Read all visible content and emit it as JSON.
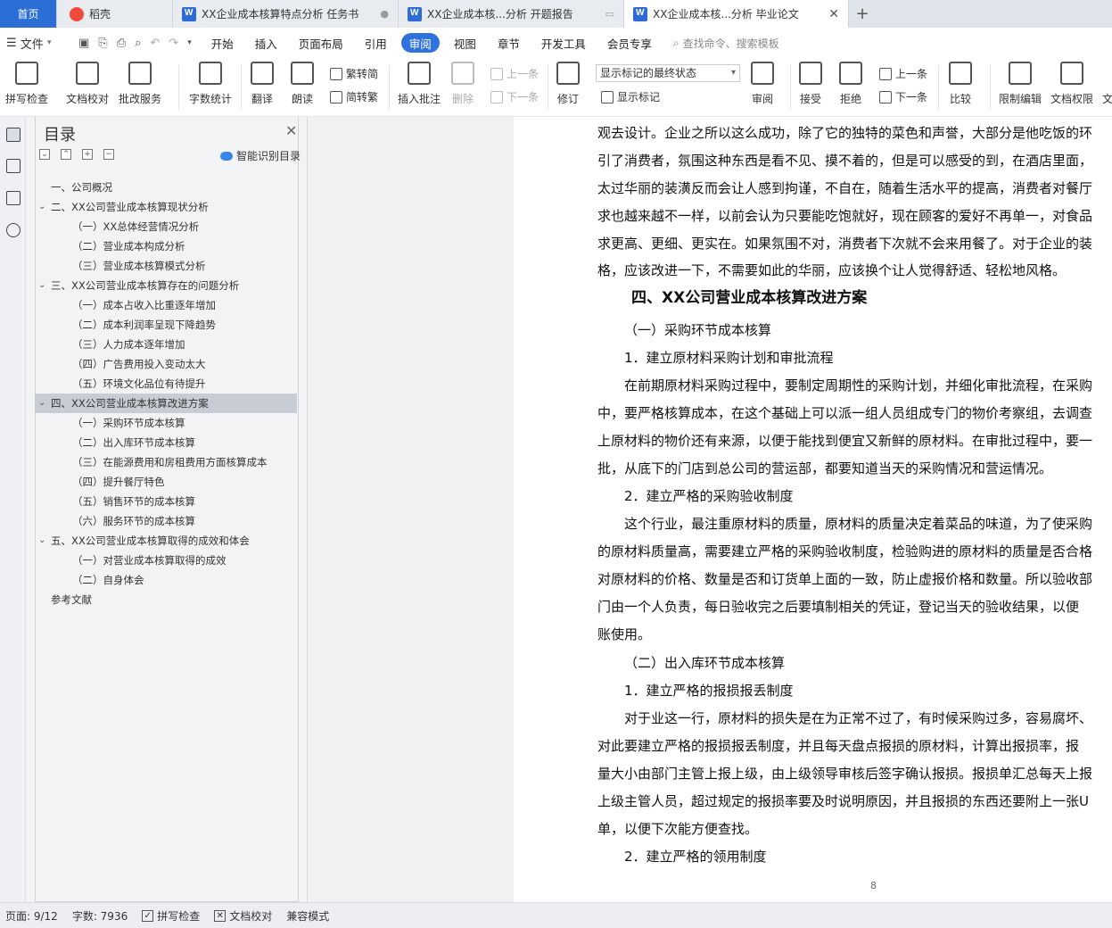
{
  "tabs": [
    {
      "label": "首页"
    },
    {
      "label": "稻壳"
    },
    {
      "label": "XX企业成本核算特点分析 任务书"
    },
    {
      "label": "XX企业成本核...分析 开题报告"
    },
    {
      "label": "XX企业成本核...分析 毕业论文"
    }
  ],
  "menu": {
    "file": "文件",
    "items": [
      "开始",
      "插入",
      "页面布局",
      "引用",
      "审阅",
      "视图",
      "章节",
      "开发工具",
      "会员专享"
    ],
    "search_placeholder": "查找命令、搜索模板"
  },
  "ribbon": {
    "spell": "拼写检查",
    "proof": "文档校对",
    "service": "批改服务",
    "wordcount": "字数统计",
    "translate": "翻译",
    "read": "朗读",
    "trad": "繁转简",
    "simp": "简转繁",
    "insert_comment": "插入批注",
    "delete": "删除",
    "prev": "上一条",
    "next": "下一条",
    "revise": "修订",
    "markup_select": "显示标记的最终状态",
    "show_markup": "显示标记",
    "review": "审阅",
    "accept": "接受",
    "reject": "拒绝",
    "prev2": "上一条",
    "next2": "下一条",
    "compare": "比较",
    "restrict": "限制编辑",
    "permission": "文档权限",
    "partial": "文"
  },
  "nav": {
    "title": "目录",
    "smart": "智能识别目录",
    "items": [
      {
        "text": "一、公司概况",
        "level": 1,
        "arrow": false
      },
      {
        "text": "二、XX公司营业成本核算现状分析",
        "level": 1,
        "arrow": true
      },
      {
        "text": "（一）XX总体经营情况分析",
        "level": 2
      },
      {
        "text": "（二）营业成本构成分析",
        "level": 2
      },
      {
        "text": "（三）营业成本核算模式分析",
        "level": 2
      },
      {
        "text": "三、XX公司营业成本核算存在的问题分析",
        "level": 1,
        "arrow": true
      },
      {
        "text": "（一）成本占收入比重逐年增加",
        "level": 2
      },
      {
        "text": "（二）成本利润率呈现下降趋势",
        "level": 2
      },
      {
        "text": "（三）人力成本逐年增加",
        "level": 2
      },
      {
        "text": "（四）广告费用投入变动太大",
        "level": 2
      },
      {
        "text": "（五）环境文化品位有待提升",
        "level": 2
      },
      {
        "text": "四、XX公司营业成本核算改进方案",
        "level": 1,
        "arrow": true,
        "selected": true
      },
      {
        "text": "（一）采购环节成本核算",
        "level": 2
      },
      {
        "text": "（二）出入库环节成本核算",
        "level": 2
      },
      {
        "text": "（三）在能源费用和房租费用方面核算成本",
        "level": 2
      },
      {
        "text": "（四）提升餐厅特色",
        "level": 2
      },
      {
        "text": "（五）销售环节的成本核算",
        "level": 2
      },
      {
        "text": "（六）服务环节的成本核算",
        "level": 2
      },
      {
        "text": "五、XX公司营业成本核算取得的成效和体会",
        "level": 1,
        "arrow": true
      },
      {
        "text": "（一）对营业成本核算取得的成效",
        "level": 2
      },
      {
        "text": "（二）自身体会",
        "level": 2
      },
      {
        "text": "参考文献",
        "level": 1,
        "arrow": false
      }
    ]
  },
  "doc": {
    "lines": [
      {
        "text": "观去设计。企业之所以这么成功，除了它的独特的菜色和声誉，大部分是他吃饭的环",
        "indent": 0
      },
      {
        "text": "引了消费者，氛围这种东西是看不见、摸不着的，但是可以感受的到，在酒店里面，",
        "indent": 0
      },
      {
        "text": "太过华丽的装潢反而会让人感到拘谨，不自在，随着生活水平的提高，消费者对餐厅",
        "indent": 0
      },
      {
        "text": "求也越来越不一样，以前会认为只要能吃饱就好，现在顾客的爱好不再单一，对食品",
        "indent": 0
      },
      {
        "text": "求更高、更细、更实在。如果氛围不对，消费者下次就不会来用餐了。对于企业的装",
        "indent": 0
      },
      {
        "text": "格，应该改进一下，不需要如此的华丽，应该换个让人觉得舒适、轻松地风格。",
        "indent": 0
      },
      {
        "text": "四、XX公司营业成本核算改进方案",
        "indent": 38,
        "heading": true
      },
      {
        "text": "（一）采购环节成本核算",
        "indent": 30
      },
      {
        "text": "1．建立原材料采购计划和审批流程",
        "indent": 30
      },
      {
        "text": "在前期原材料采购过程中，要制定周期性的采购计划，并细化审批流程，在采购",
        "indent": 30
      },
      {
        "text": "中，要严格核算成本，在这个基础上可以派一组人员组成专门的物价考察组，去调查",
        "indent": 0
      },
      {
        "text": "上原材料的物价还有来源，以便于能找到便宜又新鲜的原材料。在审批过程中，要一",
        "indent": 0
      },
      {
        "text": "批，从底下的门店到总公司的营运部，都要知道当天的采购情况和营运情况。",
        "indent": 0
      },
      {
        "text": "2．建立严格的采购验收制度",
        "indent": 30
      },
      {
        "text": "这个行业，最注重原材料的质量，原材料的质量决定着菜品的味道，为了使采购",
        "indent": 30
      },
      {
        "text": "的原材料质量高，需要建立严格的采购验收制度，检验购进的原材料的质量是否合格",
        "indent": 0
      },
      {
        "text": "对原材料的价格、数量是否和订货单上面的一致，防止虚报价格和数量。所以验收部",
        "indent": 0
      },
      {
        "text": "门由一个人负责，每日验收完之后要填制相关的凭证，登记当天的验收结果，以便",
        "indent": 0
      },
      {
        "text": "账使用。",
        "indent": 0
      },
      {
        "text": "（二）出入库环节成本核算",
        "indent": 30
      },
      {
        "text": "1．建立严格的报损报丢制度",
        "indent": 30
      },
      {
        "text": "对于业这一行，原材料的损失是在为正常不过了，有时候采购过多，容易腐坏、",
        "indent": 30
      },
      {
        "text": "对此要建立严格的报损报丢制度，并且每天盘点报损的原材料，计算出报损率，报",
        "indent": 0
      },
      {
        "text": "量大小由部门主管上报上级，由上级领导审核后签字确认报损。报损单汇总每天上报",
        "indent": 0
      },
      {
        "text": "上级主管人员，超过规定的报损率要及时说明原因，并且报损的东西还要附上一张U",
        "indent": 0
      },
      {
        "text": "单，以便下次能方便查找。",
        "indent": 0
      },
      {
        "text": "2．建立严格的领用制度",
        "indent": 30
      }
    ],
    "page_number": "8"
  },
  "status": {
    "page": "页面: 9/12",
    "words": "字数: 7936",
    "spell": "拼写检查",
    "proof": "文档校对",
    "compat": "兼容模式"
  }
}
